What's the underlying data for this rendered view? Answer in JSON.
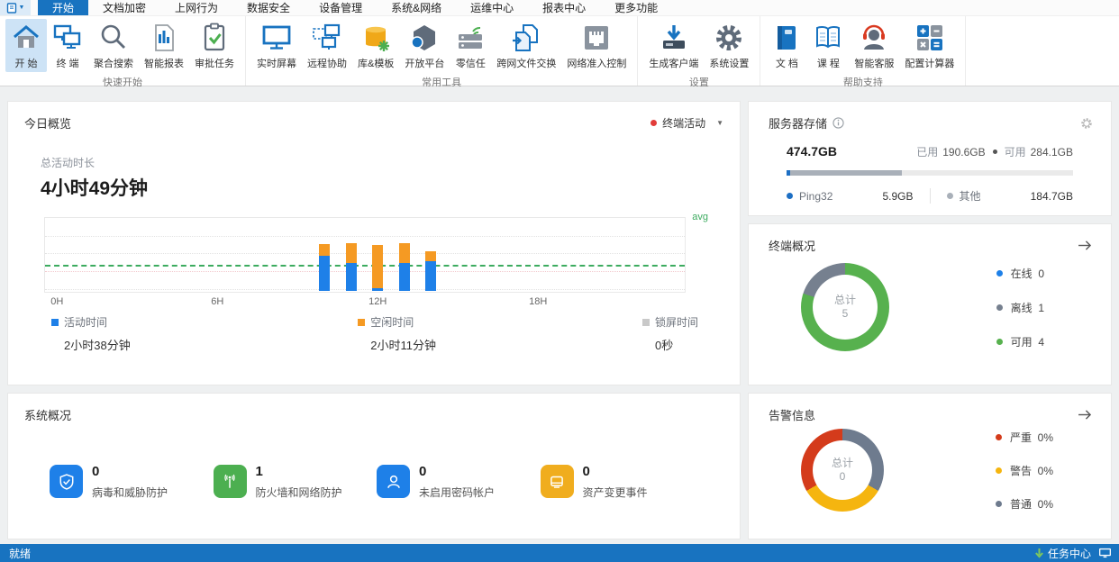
{
  "menubar": {
    "tabs": [
      {
        "label": "开始",
        "active": true
      },
      {
        "label": "文档加密",
        "active": false
      },
      {
        "label": "上网行为",
        "active": false
      },
      {
        "label": "数据安全",
        "active": false
      },
      {
        "label": "设备管理",
        "active": false
      },
      {
        "label": "系统&网络",
        "active": false
      },
      {
        "label": "运维中心",
        "active": false
      },
      {
        "label": "报表中心",
        "active": false
      },
      {
        "label": "更多功能",
        "active": false
      }
    ]
  },
  "ribbon": {
    "groups": [
      {
        "label": "快速开始",
        "items": [
          {
            "label": "开 始",
            "icon": "home-icon",
            "active": true
          },
          {
            "label": "终 端",
            "icon": "terminal-icon"
          },
          {
            "label": "聚合搜索",
            "icon": "search-icon"
          },
          {
            "label": "智能报表",
            "icon": "report-icon"
          },
          {
            "label": "审批任务",
            "icon": "approve-task-icon"
          }
        ]
      },
      {
        "label": "常用工具",
        "items": [
          {
            "label": "实时屏幕",
            "icon": "screen-icon"
          },
          {
            "label": "远程协助",
            "icon": "remote-assist-icon"
          },
          {
            "label": "库&模板",
            "icon": "library-icon"
          },
          {
            "label": "开放平台",
            "icon": "platform-icon"
          },
          {
            "label": "零信任",
            "icon": "zero-trust-icon"
          },
          {
            "label": "跨网文件交换",
            "icon": "file-exchange-icon"
          },
          {
            "label": "网络准入控制",
            "icon": "network-access-icon"
          }
        ]
      },
      {
        "label": "设置",
        "items": [
          {
            "label": "生成客户端",
            "icon": "generate-client-icon"
          },
          {
            "label": "系统设置",
            "icon": "gear-icon"
          }
        ]
      },
      {
        "label": "帮助支持",
        "items": [
          {
            "label": "文 档",
            "icon": "document-icon"
          },
          {
            "label": "课 程",
            "icon": "course-icon"
          },
          {
            "label": "智能客服",
            "icon": "support-agent-icon"
          },
          {
            "label": "配置计算器",
            "icon": "calculator-icon"
          }
        ]
      }
    ]
  },
  "panels": {
    "today": {
      "title": "今日概览",
      "selector": {
        "label": "终端活动",
        "dot_color": "#e23c39"
      },
      "total_label": "总活动时长",
      "total_value": "4小时49分钟",
      "legend": [
        {
          "label": "活动时间",
          "value": "2小时38分钟",
          "color": "#1e80e8"
        },
        {
          "label": "空闲时间",
          "value": "2小时11分钟",
          "color": "#f59a23"
        },
        {
          "label": "锁屏时间",
          "value": "0秒",
          "color": "#c9c9c9"
        }
      ]
    },
    "storage": {
      "title": "服务器存储",
      "total": "474.7GB",
      "used_label": "已用",
      "used_value": "190.6GB",
      "free_label": "可用",
      "free_value": "284.1GB",
      "bar": [
        {
          "color": "#1d6fc4",
          "pct": 1.3
        },
        {
          "color": "#a9b0b9",
          "pct": 38.9
        },
        {
          "color": "#eaeaea",
          "pct": 59.8
        }
      ],
      "items": [
        {
          "label": "Ping32",
          "value": "5.9GB",
          "color": "#1d6fc4"
        },
        {
          "label": "其他",
          "value": "184.7GB",
          "color": "#a9b0b9"
        }
      ]
    },
    "terminal": {
      "title": "终端概况",
      "center_label": "总计",
      "center_value": "5",
      "legend": [
        {
          "label": "在线",
          "value": "0",
          "color": "#1e80e8"
        },
        {
          "label": "离线",
          "value": "1",
          "color": "#76808f"
        },
        {
          "label": "可用",
          "value": "4",
          "color": "#57b14e"
        }
      ]
    },
    "system": {
      "title": "系统概况",
      "items": [
        {
          "value": "0",
          "label": "病毒和威胁防护",
          "icon": "shield-check-icon",
          "color": "#1e80e8"
        },
        {
          "value": "1",
          "label": "防火墙和网络防护",
          "icon": "firewall-signal-icon",
          "color": "#4caf50"
        },
        {
          "value": "0",
          "label": "未启用密码帐户",
          "icon": "user-account-icon",
          "color": "#1e80e8"
        },
        {
          "value": "0",
          "label": "资产变更事件",
          "icon": "asset-change-icon",
          "color": "#f0ad1e"
        }
      ]
    },
    "alerts": {
      "title": "告警信息",
      "center_label": "总计",
      "center_value": "0",
      "legend": [
        {
          "label": "严重",
          "value": "0%",
          "color": "#d43b1b"
        },
        {
          "label": "警告",
          "value": "0%",
          "color": "#f5b50f"
        },
        {
          "label": "普通",
          "value": "0%",
          "color": "#6e7b8e"
        }
      ]
    }
  },
  "statusbar": {
    "ready": "就绪",
    "task_center": "任务中心"
  },
  "chart_data": [
    {
      "type": "bar",
      "stacked": true,
      "title": "终端活动(今日概览)",
      "x_axis": {
        "ticks": [
          "0H",
          "6H",
          "12H",
          "18H"
        ],
        "range_hours": [
          0,
          24
        ]
      },
      "y_axis": {
        "unit": "minutes",
        "range": [
          0,
          94
        ],
        "gridlines_pct_from_top": [
          24,
          48,
          72,
          96
        ]
      },
      "bars": [
        {
          "hour": 10,
          "active_min": 45,
          "idle_min": 15,
          "locked_min": 0
        },
        {
          "hour": 11,
          "active_min": 35,
          "idle_min": 26,
          "locked_min": 0
        },
        {
          "hour": 12,
          "active_min": 3,
          "idle_min": 55,
          "locked_min": 0
        },
        {
          "hour": 13,
          "active_min": 36,
          "idle_min": 25,
          "locked_min": 0
        },
        {
          "hour": 14,
          "active_min": 38,
          "idle_min": 13,
          "locked_min": 0
        }
      ],
      "series_colors": {
        "active": "#1e80e8",
        "idle": "#f59a23",
        "locked": "#c9c9c9"
      },
      "avg_line": {
        "label": "avg",
        "value_min": 31.6,
        "color": "#3cab5f"
      },
      "totals": {
        "active": "2小时38分钟",
        "idle": "2小时11分钟",
        "locked": "0秒",
        "overall": "4小时49分钟"
      }
    },
    {
      "type": "donut",
      "title": "终端概况",
      "center": {
        "label": "总计",
        "value": 5
      },
      "slices": [
        {
          "label": "在线",
          "value": 0,
          "color": "#1e80e8"
        },
        {
          "label": "可用",
          "value": 4,
          "color": "#57b14e"
        },
        {
          "label": "离线",
          "value": 1,
          "color": "#76808f"
        }
      ],
      "legend_position": "right"
    },
    {
      "type": "donut",
      "title": "告警信息",
      "center": {
        "label": "总计",
        "value": 0
      },
      "slices": [
        {
          "label": "普通",
          "value": "0%",
          "color": "#6e7b8e"
        },
        {
          "label": "警告",
          "value": "0%",
          "color": "#f5b50f"
        },
        {
          "label": "严重",
          "value": "0%",
          "color": "#d43b1b"
        }
      ],
      "legend_position": "right"
    }
  ]
}
